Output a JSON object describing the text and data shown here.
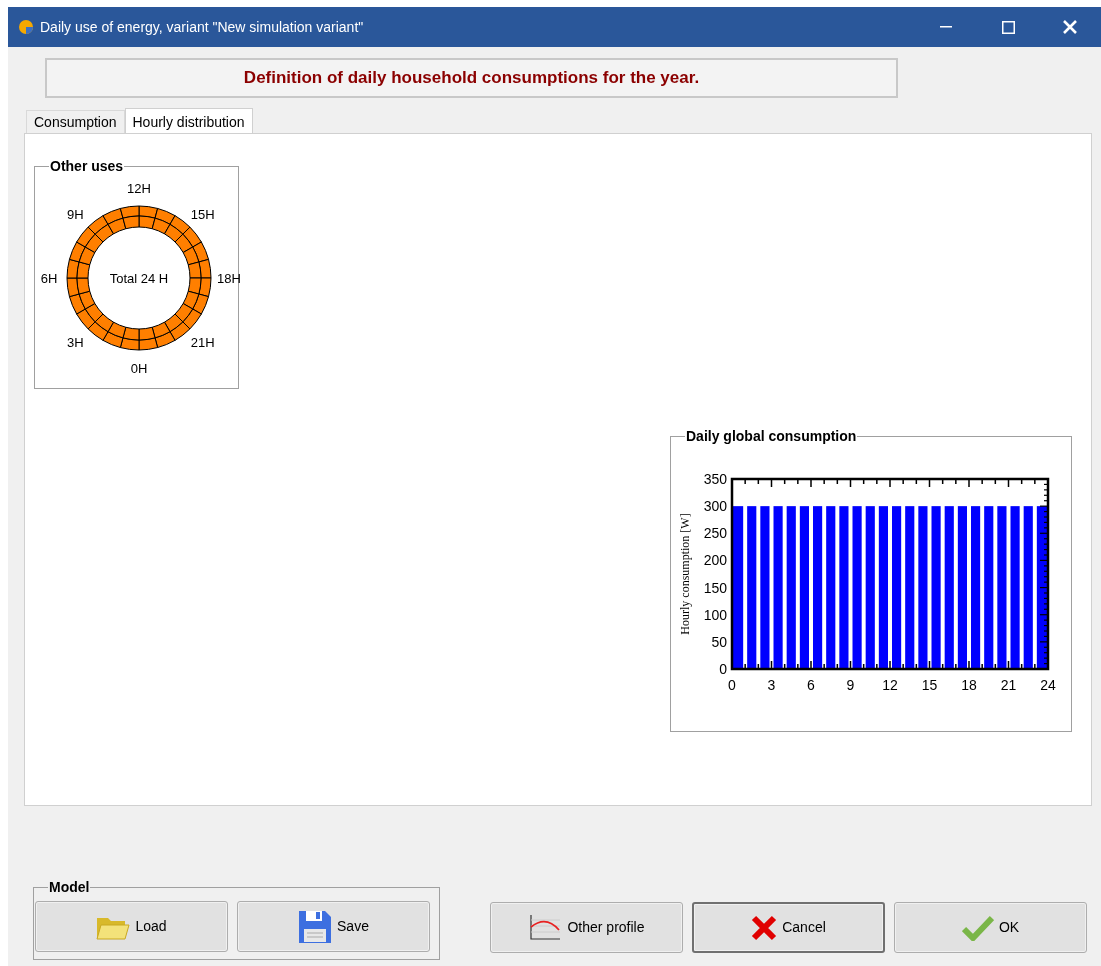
{
  "window": {
    "title": "Daily use of energy, variant \"New simulation variant\""
  },
  "header": "Definition of daily household consumptions for the year.",
  "tabs": [
    {
      "label": "Consumption",
      "selected": false
    },
    {
      "label": "Hourly distribution",
      "selected": true
    }
  ],
  "other_uses": {
    "title": "Other uses",
    "hour_labels": [
      "12H",
      "15H",
      "18H",
      "21H",
      "0H",
      "3H",
      "6H",
      "9H"
    ],
    "center": "Total 24 H"
  },
  "daily_chart": {
    "title": "Daily global consumption",
    "chart_data": {
      "type": "bar",
      "ylabel": "Hourly consumption [W]",
      "x": [
        0.5,
        1.5,
        2.5,
        3.5,
        4.5,
        5.5,
        6.5,
        7.5,
        8.5,
        9.5,
        10.5,
        11.5,
        12.5,
        13.5,
        14.5,
        15.5,
        16.5,
        17.5,
        18.5,
        19.5,
        20.5,
        21.5,
        22.5,
        23.5
      ],
      "values": [
        300,
        300,
        300,
        300,
        300,
        300,
        300,
        300,
        300,
        300,
        300,
        300,
        300,
        300,
        300,
        300,
        300,
        300,
        300,
        300,
        300,
        300,
        300,
        300
      ],
      "xlim": [
        0,
        24
      ],
      "ylim": [
        0,
        350
      ],
      "xticks": [
        0,
        3,
        6,
        9,
        12,
        15,
        18,
        21,
        24
      ],
      "yticks": [
        0,
        50,
        100,
        150,
        200,
        250,
        300,
        350
      ]
    }
  },
  "model": {
    "title": "Model",
    "buttons": [
      {
        "label": "Load",
        "kind": "load"
      },
      {
        "label": "Save",
        "kind": "save"
      }
    ]
  },
  "buttons": [
    {
      "label": "Other profile",
      "kind": "profile",
      "focused": false
    },
    {
      "label": "Cancel",
      "kind": "cancel",
      "focused": true
    },
    {
      "label": "OK",
      "kind": "ok",
      "focused": false
    }
  ]
}
